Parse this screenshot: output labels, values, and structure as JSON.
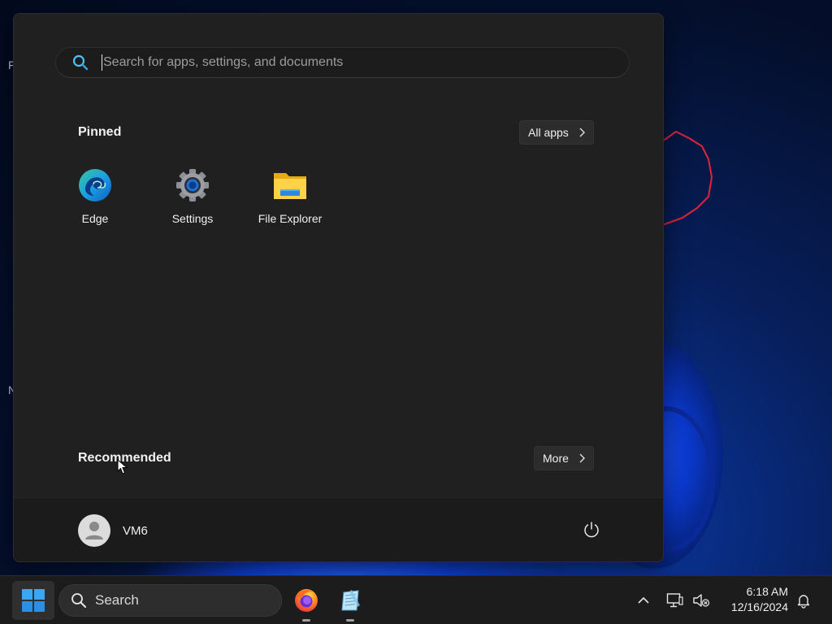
{
  "desktop": {
    "edge_letters": [
      "F",
      "N"
    ]
  },
  "start_menu": {
    "search": {
      "placeholder": "Search for apps, settings, and documents",
      "value": ""
    },
    "pinned": {
      "title": "Pinned",
      "all_apps_label": "All apps",
      "apps": [
        {
          "label": "Edge",
          "icon": "edge-icon"
        },
        {
          "label": "Settings",
          "icon": "gear-icon"
        },
        {
          "label": "File Explorer",
          "icon": "folder-icon"
        }
      ]
    },
    "recommended": {
      "title": "Recommended",
      "more_label": "More"
    },
    "user": {
      "name": "VM6",
      "power_icon": "power-icon"
    }
  },
  "taskbar": {
    "search_label": "Search",
    "apps": [
      {
        "icon": "firefox-icon"
      },
      {
        "icon": "notepad-icon"
      }
    ],
    "tray": {
      "icons": [
        "chevron-up-icon",
        "network-icon",
        "volume-muted-icon",
        "bell-icon"
      ]
    },
    "clock": {
      "time": "6:18 AM",
      "date": "12/16/2024"
    }
  },
  "colors": {
    "start_bg": "#202020",
    "taskbar_bg": "#1c1c1c",
    "accent": "#4cc2ff",
    "annotation_red": "#e0243a"
  }
}
